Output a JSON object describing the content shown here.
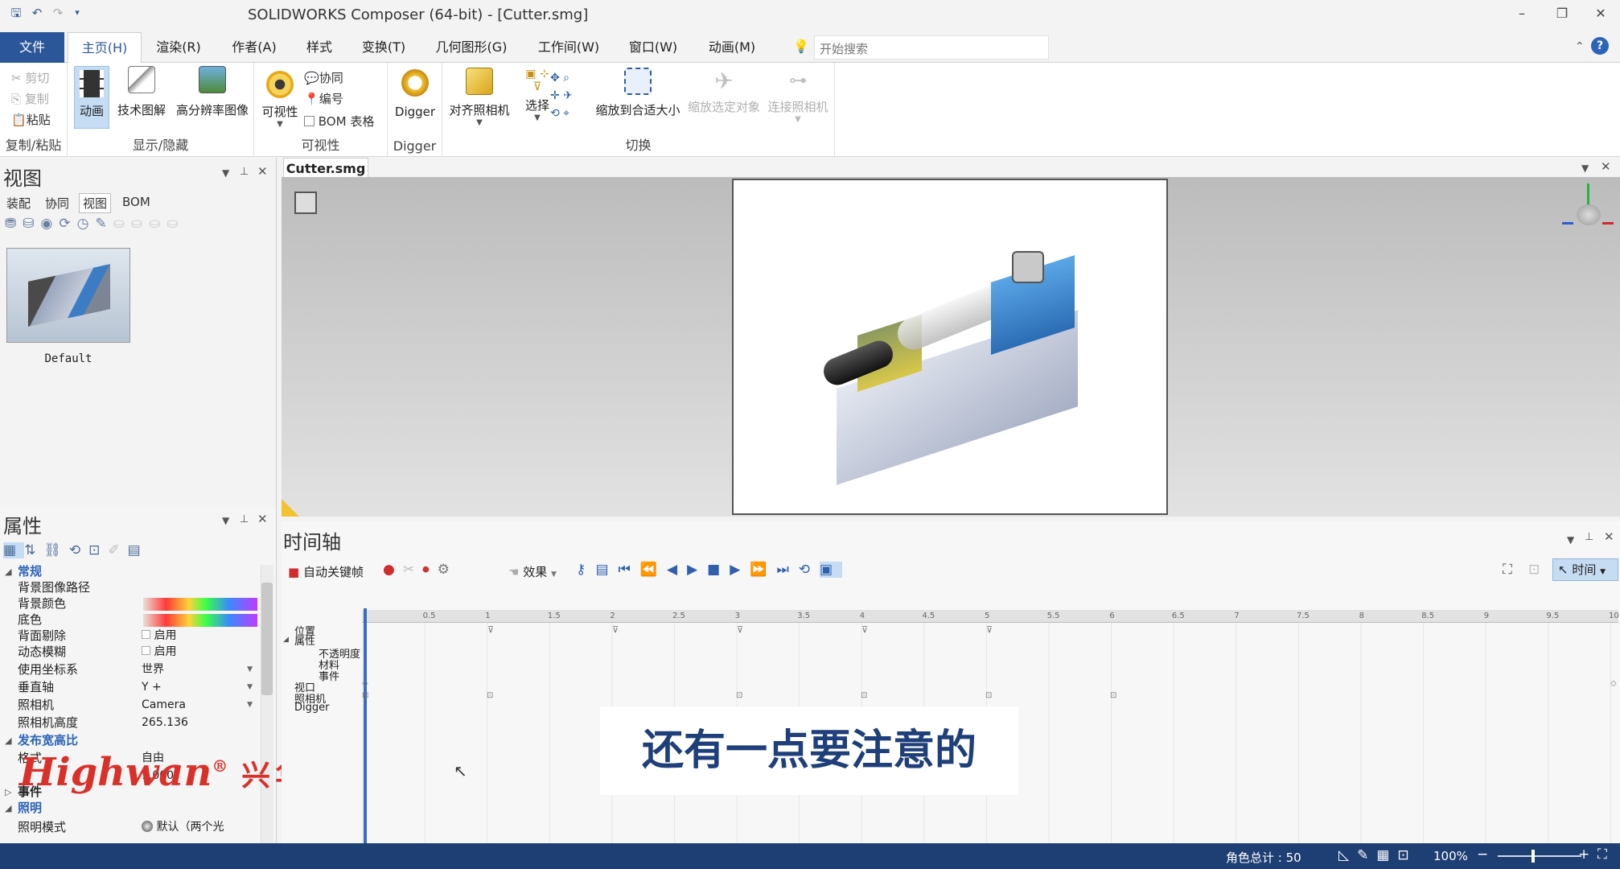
{
  "app": {
    "title": "SOLIDWORKS Composer (64-bit) - [Cutter.smg]"
  },
  "menu": {
    "file": "文件",
    "tabs": [
      "主页(H)",
      "渲染(R)",
      "作者(A)",
      "样式",
      "变换(T)",
      "几何图形(G)",
      "工作间(W)",
      "窗口(W)",
      "动画(M)"
    ],
    "search_placeholder": "开始搜索"
  },
  "ribbon": {
    "clipboard": {
      "cut": "剪切",
      "copy": "复制",
      "paste": "粘贴",
      "label": "复制/粘贴"
    },
    "show": {
      "anim": "动画",
      "tech": "技术图解",
      "hires": "高分辨率图像",
      "label": "显示/隐藏"
    },
    "visibility": {
      "visible": "可视性",
      "collab": "协同",
      "number": "编号",
      "bom": "BOM 表格",
      "label": "可视性"
    },
    "digger": {
      "btn": "Digger",
      "label": "Digger"
    },
    "switch": {
      "align": "对齐照相机",
      "select": "选择",
      "fit": "缩放到合适大小",
      "zoomsel": "缩放选定对象",
      "connect": "连接照相机",
      "label": "切换"
    }
  },
  "views": {
    "title": "视图",
    "tabs": [
      "装配",
      "协同",
      "视图",
      "BOM"
    ],
    "active_tab": "视图",
    "thumb_label": "Default"
  },
  "document": {
    "tab": "Cutter.smg"
  },
  "properties": {
    "title": "属性",
    "sections": {
      "general": "常规",
      "aspect": "发布宽高比",
      "event": "事件",
      "lighting": "照明"
    },
    "rows": {
      "bg_path": "背景图像路径",
      "bg_color": "背景颜色",
      "floor_color": "底色",
      "backface": "背面剔除",
      "backface_val": "启用",
      "motion_blur": "动态模糊",
      "motion_blur_val": "启用",
      "coord": "使用坐标系",
      "coord_val": "世界",
      "vertical": "垂直轴",
      "vertical_val": "Y +",
      "camera": "照相机",
      "camera_val": "Camera",
      "cam_height": "照相机高度",
      "cam_height_val": "265.136",
      "format": "格式",
      "format_val": "自由",
      "ratio_val": "1.000",
      "light_mode": "照明模式",
      "light_mode_val": "默认（两个光"
    }
  },
  "timeline": {
    "title": "时间轴",
    "autokey": "自动关键帧",
    "effects": "效果",
    "mode": "时间",
    "ticks": [
      "0.5",
      "1",
      "1.5",
      "2",
      "2.5",
      "3",
      "3.5",
      "4",
      "4.5",
      "5",
      "5.5",
      "6",
      "6.5",
      "7",
      "7.5",
      "8",
      "8.5",
      "9",
      "9.5",
      "10"
    ],
    "tracks": [
      "位置",
      "属性",
      "不透明度",
      "材料",
      "事件",
      "视口",
      "照相机",
      "Digger"
    ]
  },
  "subtitle": "还有一点要注意的",
  "watermark": {
    "brand": "Highwan",
    "cn": "兴华学院"
  },
  "status": {
    "actors": "角色总计 : 50",
    "zoom": "100%"
  },
  "colors": {
    "accent": "#2b579a",
    "status_bar": "#1e3f74",
    "subtitle_text": "#1f3f7a",
    "watermark": "#d9312a"
  }
}
